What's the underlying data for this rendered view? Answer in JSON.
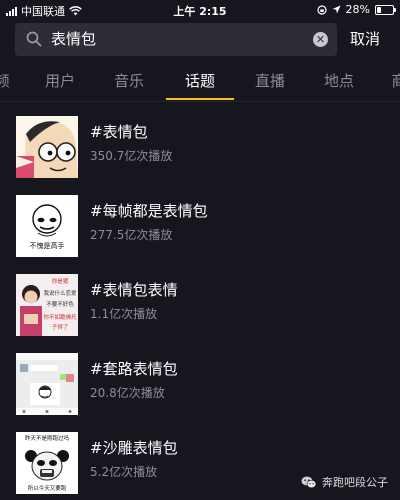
{
  "status_bar": {
    "carrier": "中国联通",
    "time": "上午 2:15",
    "battery": "28%",
    "battery_level": 0.28
  },
  "search": {
    "query": "表情包",
    "cancel_label": "取消"
  },
  "tabs": [
    {
      "label": "频",
      "active": false
    },
    {
      "label": "用户",
      "active": false
    },
    {
      "label": "音乐",
      "active": false
    },
    {
      "label": "话题",
      "active": true
    },
    {
      "label": "直播",
      "active": false
    },
    {
      "label": "地点",
      "active": false
    },
    {
      "label": "商",
      "active": false
    }
  ],
  "accent_color": "#f7c21e",
  "topics": [
    {
      "title": "#表情包",
      "plays": "350.7亿次播放"
    },
    {
      "title": "#每帧都是表情包",
      "plays": "277.5亿次播放",
      "thumb_caption": "不愧是高手"
    },
    {
      "title": "#表情包表情",
      "plays": "1.1亿次播放",
      "thumb_lines": [
        "你是猪",
        "我说什么恋爱",
        "不要不好色",
        "你不如跪佛托",
        "子得了"
      ]
    },
    {
      "title": "#套路表情包",
      "plays": "20.8亿次播放"
    },
    {
      "title": "#沙雕表情包",
      "plays": "5.2亿次播放",
      "thumb_top": "昨天不是刚跑过吗",
      "thumb_bottom": "所以今天又要跑"
    }
  ],
  "watermark": {
    "text": "奔跑吧段公子"
  }
}
